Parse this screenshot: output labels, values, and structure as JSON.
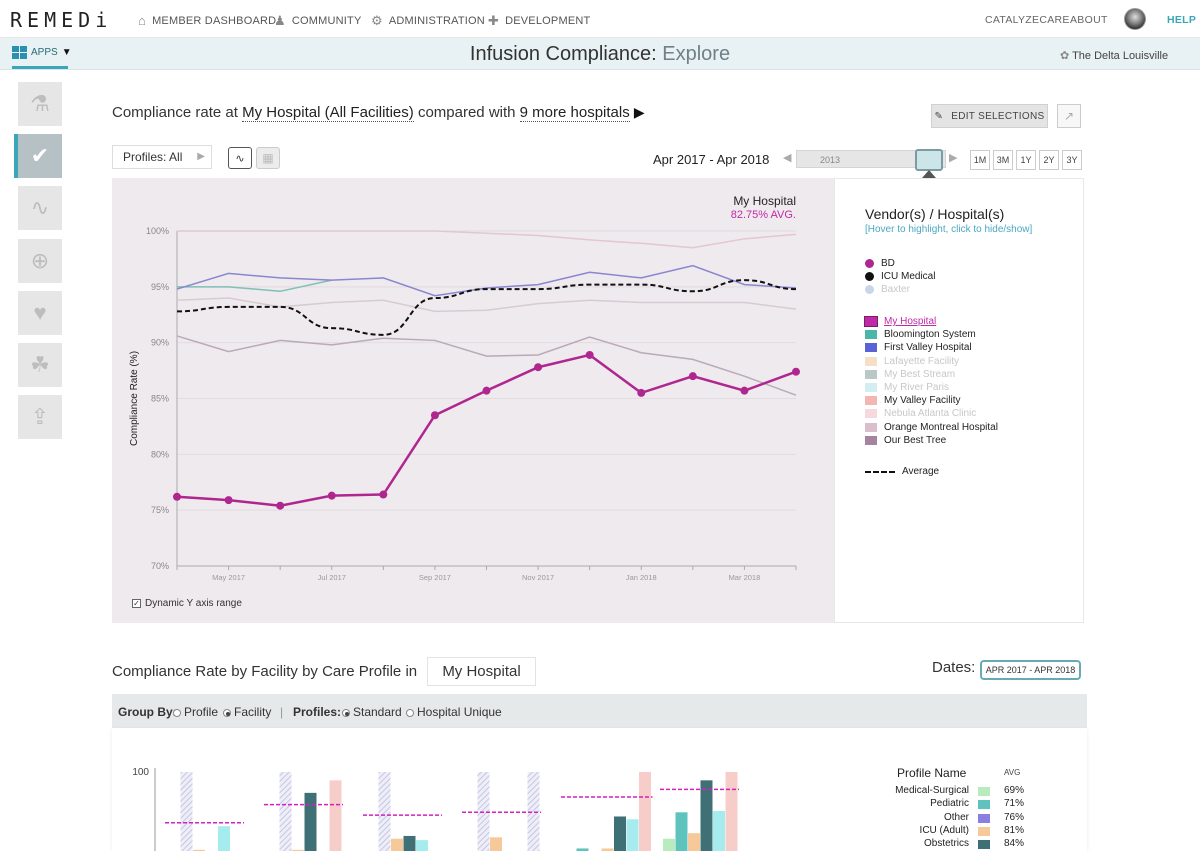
{
  "brand": {
    "logo": "REMEDi"
  },
  "nav": {
    "items": [
      "MEMBER DASHBOARD",
      "COMMUNITY",
      "ADMINISTRATION",
      "DEVELOPMENT"
    ],
    "right": [
      "CATALYZECARE",
      "ABOUT"
    ],
    "help": "HELP"
  },
  "titlebar": {
    "apps_label": "APPS",
    "title_main": "Infusion Compliance: ",
    "title_sub": "Explore",
    "org": "The Delta Louisville"
  },
  "compare": {
    "prefix": "Compliance rate at ",
    "hospital": "My Hospital (All Facilities)",
    "mid": " compared with ",
    "more": "9 more hospitals",
    "edit_label": "EDIT SELECTIONS"
  },
  "controls": {
    "profiles": "Profiles: All",
    "date_range": "Apr 2017 - Apr 2018",
    "slider_label": "2013",
    "ranges": [
      "1M",
      "3M",
      "1Y",
      "2Y",
      "3Y"
    ]
  },
  "tooltip": {
    "name": "My Hospital",
    "avg": "82.75% AVG."
  },
  "legend": {
    "title": "Vendor(s) / Hospital(s)",
    "hint": "[Hover to highlight, click to hide/show]",
    "vendors": [
      {
        "name": "BD",
        "color": "#b0268f",
        "faded": false
      },
      {
        "name": "ICU Medical",
        "color": "#111111",
        "faded": false
      },
      {
        "name": "Baxter",
        "color": "#c8d6e8",
        "faded": true
      }
    ],
    "hospitals": [
      {
        "name": "My Hospital",
        "color": "#c02aa6",
        "faded": false
      },
      {
        "name": "Bloomington System",
        "color": "#4bb5a9",
        "faded": false
      },
      {
        "name": "First Valley Hospital",
        "color": "#5a63d6",
        "faded": false
      },
      {
        "name": "Lafayette Facility",
        "color": "#f5dfc9",
        "faded": true
      },
      {
        "name": "My Best Stream",
        "color": "#b9c7c7",
        "faded": true
      },
      {
        "name": "My River Paris",
        "color": "#d3eef0",
        "faded": true
      },
      {
        "name": "My Valley Facility",
        "color": "#f4b6b3",
        "faded": false
      },
      {
        "name": "Nebula Atlanta Clinic",
        "color": "#f6d8dd",
        "faded": true
      },
      {
        "name": "Orange Montreal Hospital",
        "color": "#d9bfcb",
        "faded": false
      },
      {
        "name": "Our Best Tree",
        "color": "#a584a0",
        "faded": false
      }
    ],
    "average_label": "Average"
  },
  "dynamic_axis_label": "Dynamic Y axis range",
  "chart_data": [
    {
      "type": "line",
      "title": "",
      "xlabel": "",
      "ylabel": "Compliance Rate (%)",
      "ylim": [
        70,
        100
      ],
      "yticks": [
        "100%",
        "95%",
        "90%",
        "85%",
        "80%",
        "75%",
        "70%"
      ],
      "x": [
        "Apr 2017",
        "May 2017",
        "Jun 2017",
        "Jul 2017",
        "Aug 2017",
        "Sep 2017",
        "Oct 2017",
        "Nov 2017",
        "Dec 2017",
        "Jan 2018",
        "Feb 2018",
        "Mar 2018",
        "Apr 2018"
      ],
      "xtick_labels": [
        "May 2017",
        "Jul 2017",
        "Sep 2017",
        "Nov 2017",
        "Jan 2018",
        "Mar 2018"
      ],
      "series": [
        {
          "name": "My Hospital",
          "color": "#b0268f",
          "markers": true,
          "values": [
            76.2,
            75.9,
            75.4,
            76.3,
            76.4,
            83.5,
            85.7,
            87.8,
            88.9,
            85.5,
            87.0,
            85.7,
            87.4
          ]
        },
        {
          "name": "Average",
          "color": "#111111",
          "dashed": true,
          "values": [
            92.8,
            93.2,
            93.2,
            91.3,
            90.7,
            94.0,
            94.8,
            94.8,
            95.2,
            95.2,
            94.6,
            95.6,
            94.8
          ]
        },
        {
          "color": "#8a86cf",
          "values": [
            94.8,
            96.2,
            95.8,
            95.6,
            95.8,
            94.2,
            94.9,
            95.2,
            96.3,
            95.8,
            96.9,
            95.2,
            94.9
          ]
        },
        {
          "color": "#7fbfb5",
          "values": [
            95.0,
            95.0,
            94.6,
            95.6,
            null,
            null,
            null,
            null,
            null,
            null,
            null,
            null,
            null
          ]
        },
        {
          "color": "#d7cbd3",
          "values": [
            93.8,
            94.0,
            93.2,
            93.6,
            93.8,
            92.8,
            92.9,
            93.5,
            93.8,
            93.6,
            93.6,
            93.6,
            93.0
          ]
        },
        {
          "color": "#b9aab6",
          "values": [
            90.6,
            89.2,
            90.2,
            89.8,
            90.4,
            90.2,
            88.8,
            88.9,
            90.5,
            89.1,
            88.5,
            87.0,
            85.3
          ]
        },
        {
          "color": "#e4c6cf",
          "values": [
            100.0,
            100.0,
            100.0,
            100.0,
            100.0,
            100.0,
            99.8,
            99.6,
            99.2,
            98.9,
            98.5,
            99.3,
            99.7
          ]
        }
      ]
    },
    {
      "type": "bar",
      "title": "",
      "ylim": [
        0,
        100
      ],
      "yticks": [
        "100"
      ],
      "note": "grouped bars by facility, partially visible"
    }
  ],
  "section2": {
    "heading": "Compliance Rate by Facility by Care Profile in",
    "facility": "My Hospital",
    "dates_label": "Dates:",
    "dates_value": "APR 2017 - APR 2018",
    "group_by_label": "Group By:",
    "group_by_options": [
      "Profile",
      "Facility"
    ],
    "separator": "|",
    "profiles_label": "Profiles:",
    "profiles_options": [
      "Standard",
      "Hospital Unique"
    ]
  },
  "profile_legend": {
    "title": "Profile Name",
    "avg_label": "AVG",
    "rows": [
      {
        "name": "Medical-Surgical",
        "avg": "69%",
        "color": "#b8ecbf"
      },
      {
        "name": "Pediatric",
        "avg": "71%",
        "color": "#5ec3bd"
      },
      {
        "name": "Other",
        "avg": "76%",
        "color": "#8a7fe0"
      },
      {
        "name": "ICU (Adult)",
        "avg": "81%",
        "color": "#f6c99b"
      },
      {
        "name": "Obstetrics",
        "avg": "84%",
        "color": "#3f7076"
      }
    ]
  }
}
